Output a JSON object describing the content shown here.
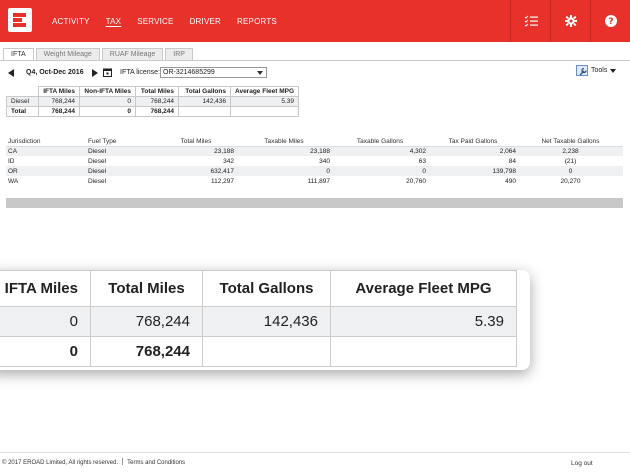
{
  "nav": {
    "items": [
      "ACTIVITY",
      "TAX",
      "SERVICE",
      "DRIVER",
      "REPORTS"
    ],
    "active": "TAX"
  },
  "tabs": [
    "IFTA",
    "Weight Mileage",
    "RUAF Mileage",
    "IRP"
  ],
  "period": {
    "label": "Q4, Oct-Dec 2016",
    "license_label": "IFTA license:",
    "license_value": "OR-3214685299"
  },
  "tools_label": "Tools",
  "summary": {
    "headers": [
      "",
      "IFTA Miles",
      "Non-IFTA Miles",
      "Total Miles",
      "Total Gallons",
      "Average Fleet MPG"
    ],
    "rows": [
      [
        "Diesel",
        "768,244",
        "0",
        "768,244",
        "142,436",
        "5.39"
      ],
      [
        "Total",
        "768,244",
        "0",
        "768,244",
        "",
        ""
      ]
    ]
  },
  "jurisdiction": {
    "headers": [
      "Jurisdiction",
      "Fuel Type",
      "Total Miles",
      "Taxable Miles",
      "Taxable Gallons",
      "Tax Paid Gallons",
      "Net Taxable Gallons"
    ],
    "rows": [
      [
        "CA",
        "Diesel",
        "23,188",
        "23,188",
        "4,302",
        "2,064",
        "2,238"
      ],
      [
        "ID",
        "Diesel",
        "342",
        "340",
        "63",
        "84",
        "(21)"
      ],
      [
        "OR",
        "Diesel",
        "632,417",
        "0",
        "0",
        "139,798",
        "0"
      ],
      [
        "WA",
        "Diesel",
        "112,297",
        "111,897",
        "20,760",
        "490",
        "20,270"
      ]
    ]
  },
  "zoom": {
    "headers": [
      "IFTA Miles",
      "Total Miles",
      "Total Gallons",
      "Average Fleet MPG"
    ],
    "rows": [
      [
        "0",
        "768,244",
        "142,436",
        "5.39"
      ],
      [
        "0",
        "768,244",
        "",
        ""
      ]
    ]
  },
  "footer": {
    "copyright": "© 2017 EROAD Limited, All rights reserved.",
    "terms": "Terms and Conditions",
    "logout": "Log out"
  },
  "colors": {
    "brand": "#e8312a",
    "row_alt": "#eef0f2"
  }
}
